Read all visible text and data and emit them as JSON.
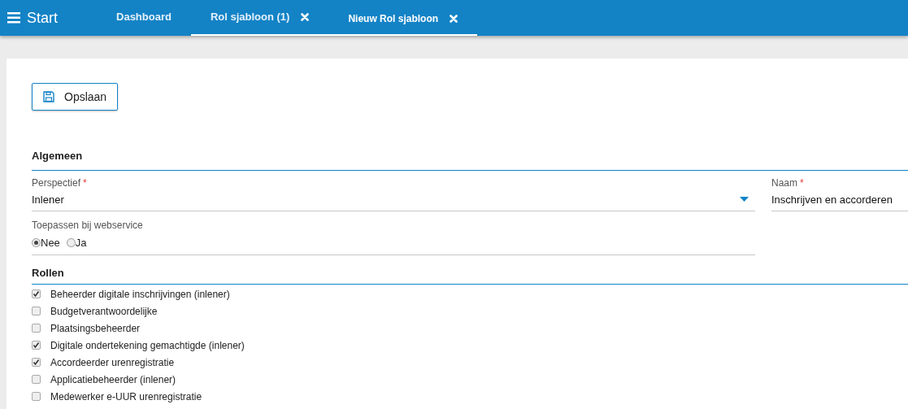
{
  "topbar": {
    "title": "Start",
    "tabs": [
      {
        "label": "Dashboard",
        "selected": false,
        "closable": false
      },
      {
        "label": "Rol sjabloon (1)",
        "selected": false,
        "closable": true
      },
      {
        "label": "Nieuw Rol sjabloon",
        "selected": true,
        "closable": true
      }
    ]
  },
  "save_button": {
    "label": "Opslaan"
  },
  "sections": [
    {
      "title": "Algemeen"
    },
    {
      "title": "Rollen"
    }
  ],
  "perspectief": {
    "label": "Perspectief",
    "required_mark": "*",
    "value": "Inlener"
  },
  "naam": {
    "label": "Naam",
    "required_mark": "*",
    "value": "Inschrijven en accorderen"
  },
  "webservice": {
    "label": "Toepassen bij webservice",
    "options": [
      {
        "label": "Nee",
        "selected": true
      },
      {
        "label": "Ja",
        "selected": false
      }
    ]
  },
  "roles": [
    {
      "label": "Beheerder digitale inschrijvingen (inlener)",
      "checked": true
    },
    {
      "label": "Budgetverantwoordelijke",
      "checked": false
    },
    {
      "label": "Plaatsingsbeheerder",
      "checked": false
    },
    {
      "label": "Digitale ondertekening gemachtigde (inlener)",
      "checked": true
    },
    {
      "label": "Accordeerder urenregistratie",
      "checked": true
    },
    {
      "label": "Applicatiebeheerder (inlener)",
      "checked": false
    },
    {
      "label": "Medewerker e-UUR urenregistratie",
      "checked": false
    }
  ]
}
